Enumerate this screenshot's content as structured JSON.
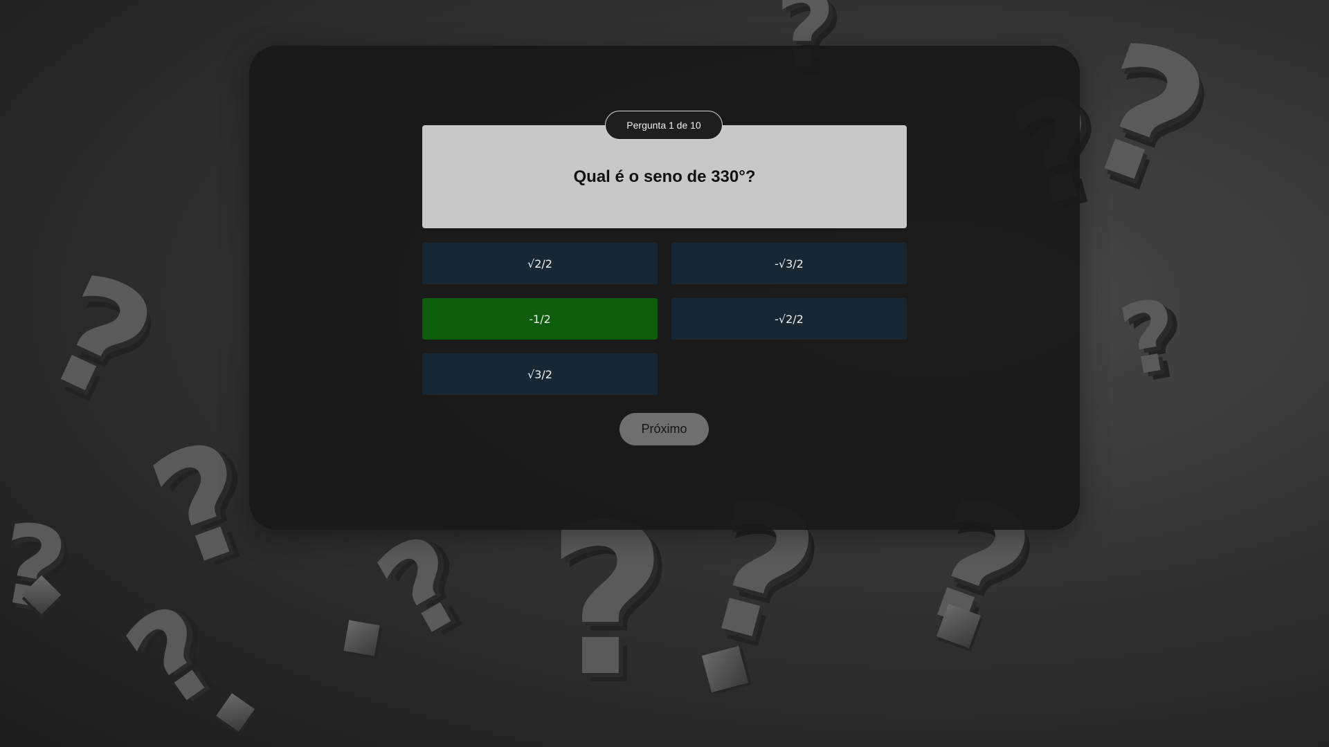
{
  "quiz": {
    "counter": "Pergunta 1 de 10",
    "question": "Qual é o seno de 330°?",
    "answers": [
      {
        "label": "√2/2",
        "state": "default"
      },
      {
        "label": "-√3/2",
        "state": "default"
      },
      {
        "label": "-1/2",
        "state": "correct"
      },
      {
        "label": "-√2/2",
        "state": "default"
      },
      {
        "label": "√3/2",
        "state": "default"
      }
    ],
    "next_label": "Próximo"
  },
  "colors": {
    "correct": "#0d5d0d",
    "answer_default": "#172733",
    "question_card": "#c8c8c8",
    "panel": "#181818"
  },
  "background": {
    "motif": "question-mark-icon"
  }
}
